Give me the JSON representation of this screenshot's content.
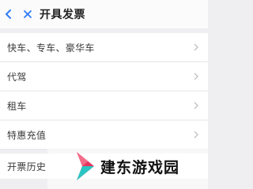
{
  "header": {
    "title": "开具发票",
    "back_icon": "chevron-left-icon",
    "close_icon": "close-icon",
    "accent_color": "#2f7cf6"
  },
  "menu": {
    "items": [
      {
        "label": "快车、专车、豪华车",
        "icon": "chevron-right-icon"
      },
      {
        "label": "代驾",
        "icon": "chevron-right-icon"
      },
      {
        "label": "租车",
        "icon": "chevron-right-icon"
      },
      {
        "label": "特惠充值",
        "icon": "chevron-right-icon"
      }
    ],
    "history_label": "开票历史"
  },
  "watermark": {
    "text": "建东游戏园"
  }
}
